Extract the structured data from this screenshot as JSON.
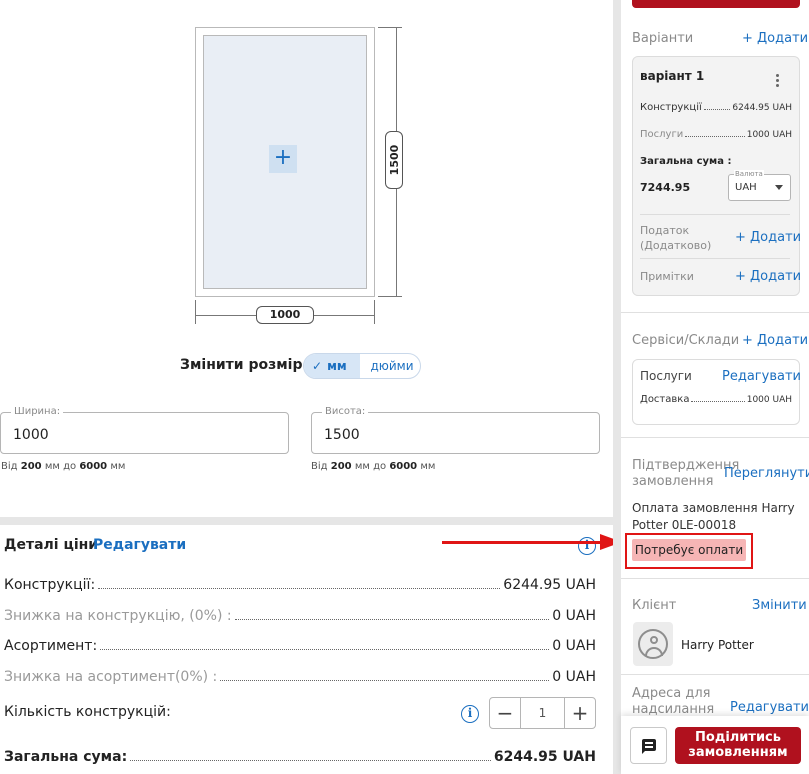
{
  "drawing": {
    "width_label": "1000",
    "height_label": "1500",
    "add_symbol": "+"
  },
  "resize": {
    "label": "Змінити розмір",
    "unit_mm": "мм",
    "unit_in": "дюйми",
    "check": "✓"
  },
  "width_field": {
    "legend": "Ширина:",
    "value": "1000",
    "hint_from": "Від",
    "hint_min": "200",
    "hint_mm1": "мм до",
    "hint_max": "6000",
    "hint_mm2": "мм"
  },
  "height_field": {
    "legend": "Висота:",
    "value": "1500",
    "hint_from": "Від",
    "hint_min": "200",
    "hint_mm1": "мм до",
    "hint_max": "6000",
    "hint_mm2": "мм"
  },
  "price": {
    "title": "Деталі ціни",
    "edit": "Редагувати",
    "info": "i",
    "rows": [
      {
        "label": "Конструкції:",
        "value": "6244.95 UAH"
      },
      {
        "label": "Знижка на конструкцію, (0%) :",
        "value": "0 UAH"
      },
      {
        "label": "Асортимент:",
        "value": "0 UAH"
      },
      {
        "label": "Знижка на асортимент(0%) :",
        "value": "0 UAH"
      }
    ],
    "qty_label": "Кількість конструкцій:",
    "qty_minus": "−",
    "qty_value": "1",
    "qty_plus": "+",
    "total_label": "Загальна сума:",
    "total_value": "6244.95 UAH"
  },
  "variants": {
    "title": "Варіанти",
    "add": "+ Додати",
    "card": {
      "name": "варіант 1",
      "constructions_label": "Конструкції",
      "constructions_value": "6244.95 UAH",
      "services_label": "Послуги",
      "services_value": "1000 UAH",
      "total_label": "Загальна сума :",
      "total_value": "7244.95",
      "currency_legend": "Валюта",
      "currency_value": "UAH",
      "tax_label_1": "Податок",
      "tax_label_2": "(Додатково)",
      "tax_add": "+ Додати",
      "notes_label": "Примітки",
      "notes_add": "+ Додати"
    }
  },
  "services": {
    "title": "Сервіси/Склади",
    "add": "+ Додати",
    "card_title": "Послуги",
    "card_edit": "Редагувати",
    "delivery_label": "Доставка",
    "delivery_value": "1000 UAH"
  },
  "confirmation": {
    "title_1": "Підтвердження",
    "title_2": "замовлення",
    "view": "Переглянути",
    "text_1": "Оплата замовлення Harry",
    "text_2": "Potter 0LE-00018",
    "badge": "Потребує оплати"
  },
  "client": {
    "title": "Клієнт",
    "change": "Змінити",
    "name": "Harry Potter"
  },
  "address": {
    "title_1": "Адреса для",
    "title_2": "надсилання",
    "edit": "Редагувати"
  },
  "footer": {
    "share_1": "Поділитись",
    "share_2": "замовленням"
  },
  "colors": {
    "accent": "#1b6fc0",
    "brand": "#b0111e",
    "alert": "#e01515",
    "badge_bg": "#f6b5b5"
  }
}
